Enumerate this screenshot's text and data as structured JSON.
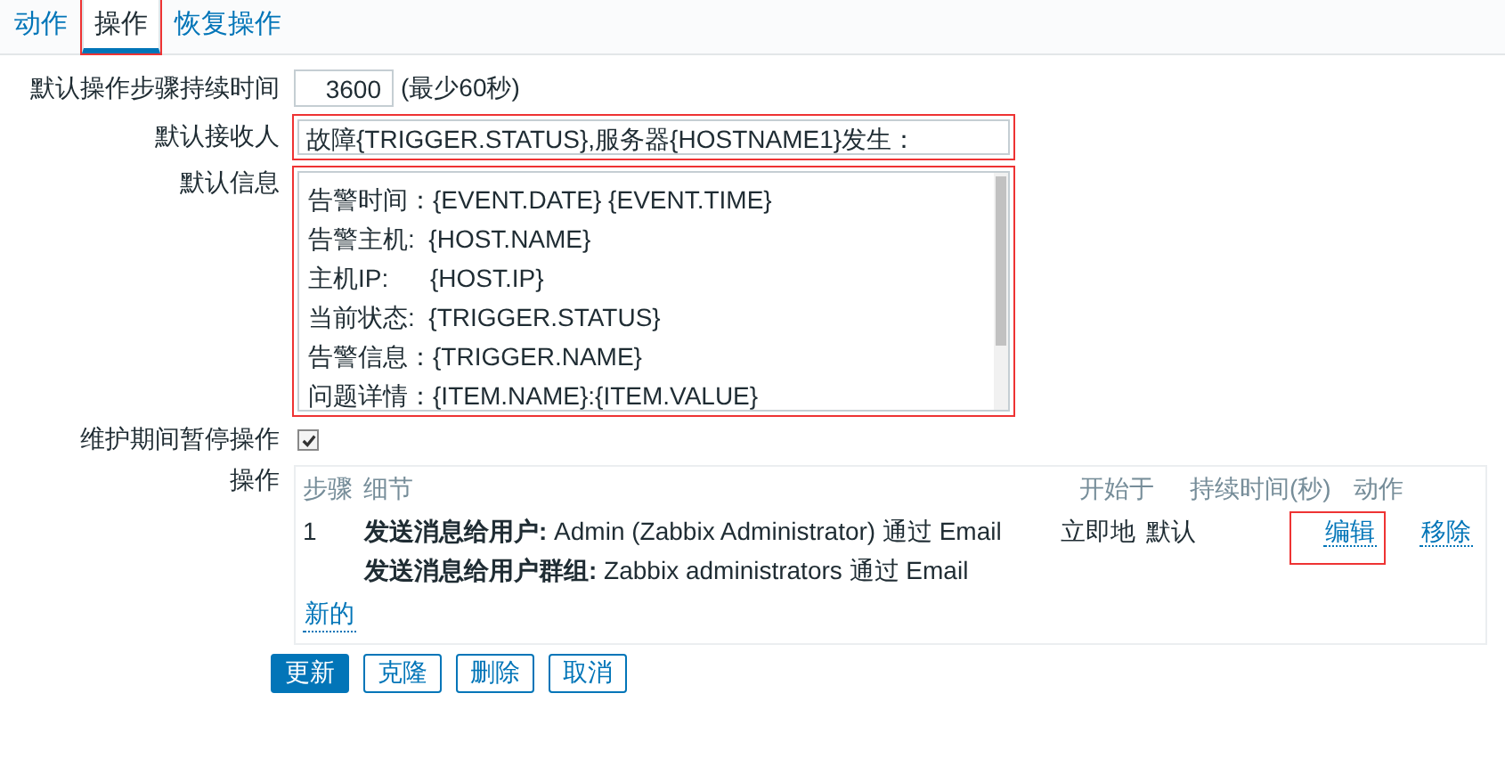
{
  "tabs": [
    {
      "label": "动作",
      "selected": false,
      "highlighted": false
    },
    {
      "label": "操作",
      "selected": true,
      "highlighted": true
    },
    {
      "label": "恢复操作",
      "selected": false,
      "highlighted": false
    }
  ],
  "step_duration": {
    "label": "默认操作步骤持续时间",
    "value": "3600",
    "hint": "(最少60秒)"
  },
  "default_subject": {
    "label": "默认接收人",
    "value": "故障{TRIGGER.STATUS},服务器{HOSTNAME1}发生：",
    "highlighted": true
  },
  "default_message": {
    "label": "默认信息",
    "highlighted": true,
    "lines": [
      "告警时间：{EVENT.DATE} {EVENT.TIME}",
      "告警主机:  {HOST.NAME}",
      "主机IP:      {HOST.IP}",
      "当前状态:  {TRIGGER.STATUS}",
      "告警信息：{TRIGGER.NAME}",
      "问题详情：{ITEM.NAME}:{ITEM.VALUE}"
    ]
  },
  "pause_in_maintenance": {
    "label": "维护期间暂停操作",
    "checked": true
  },
  "operations": {
    "label": "操作",
    "columns": [
      "步骤",
      "细节",
      "开始于",
      "持续时间(秒)",
      "动作"
    ],
    "rows": [
      {
        "step": "1",
        "details": [
          "**发送消息给用户:** Admin (Zabbix Administrator) 通过 Email",
          "**发送消息给用户群组:** Zabbix administrators 通过 Email"
        ],
        "start": "立即地",
        "duration": "默认",
        "actions": [
          {
            "label": "编辑",
            "highlighted": true
          },
          {
            "label": "移除",
            "highlighted": false
          }
        ]
      }
    ],
    "new_link": "新的"
  },
  "buttons": [
    {
      "label": "更新",
      "kind": "primary"
    },
    {
      "label": "克隆",
      "kind": "secondary"
    },
    {
      "label": "删除",
      "kind": "secondary"
    },
    {
      "label": "取消",
      "kind": "secondary"
    }
  ]
}
